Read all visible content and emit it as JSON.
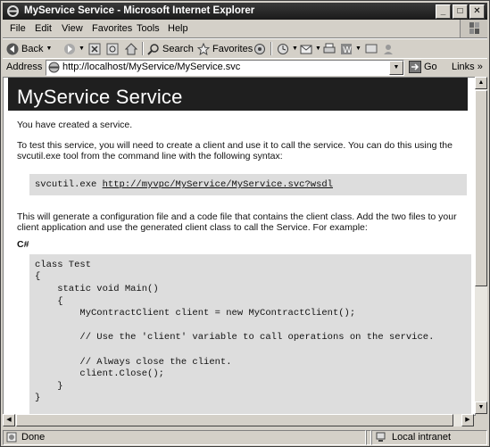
{
  "window": {
    "title": "MyService Service - Microsoft Internet Explorer",
    "buttons": {
      "minimize": "_",
      "maximize": "□",
      "close": "✕"
    }
  },
  "menu": [
    "File",
    "Edit",
    "View",
    "Favorites",
    "Tools",
    "Help"
  ],
  "toolbar": {
    "back_label": "Back",
    "search_label": "Search",
    "favorites_label": "Favorites"
  },
  "address": {
    "label": "Address",
    "url": "http://localhost/MyService/MyService.svc",
    "go_label": "Go",
    "links_label": "Links"
  },
  "page": {
    "heading": "MyService Service",
    "p1": "You have created a service.",
    "p2": "To test this service, you will need to create a client and use it to call the service. You can do this using the svcutil.exe tool from the command line with the following syntax:",
    "cmd_prefix": "svcutil.exe ",
    "cmd_url": "http://myvpc/MyService/MyService.svc?wsdl",
    "p3": "This will generate a configuration file and a code file that contains the client class. Add the two files to your client application and use the generated client class to call the Service. For example:",
    "lang": "C#",
    "code": [
      "class Test",
      "{",
      "    static void Main()",
      "    {",
      "        MyContractClient client = new MyContractClient();",
      "",
      "        // Use the 'client' variable to call operations on the service.",
      "",
      "        // Always close the client.",
      "        client.Close();",
      "    }",
      "}"
    ]
  },
  "status": {
    "text": "Done",
    "zone": "Local intranet"
  }
}
